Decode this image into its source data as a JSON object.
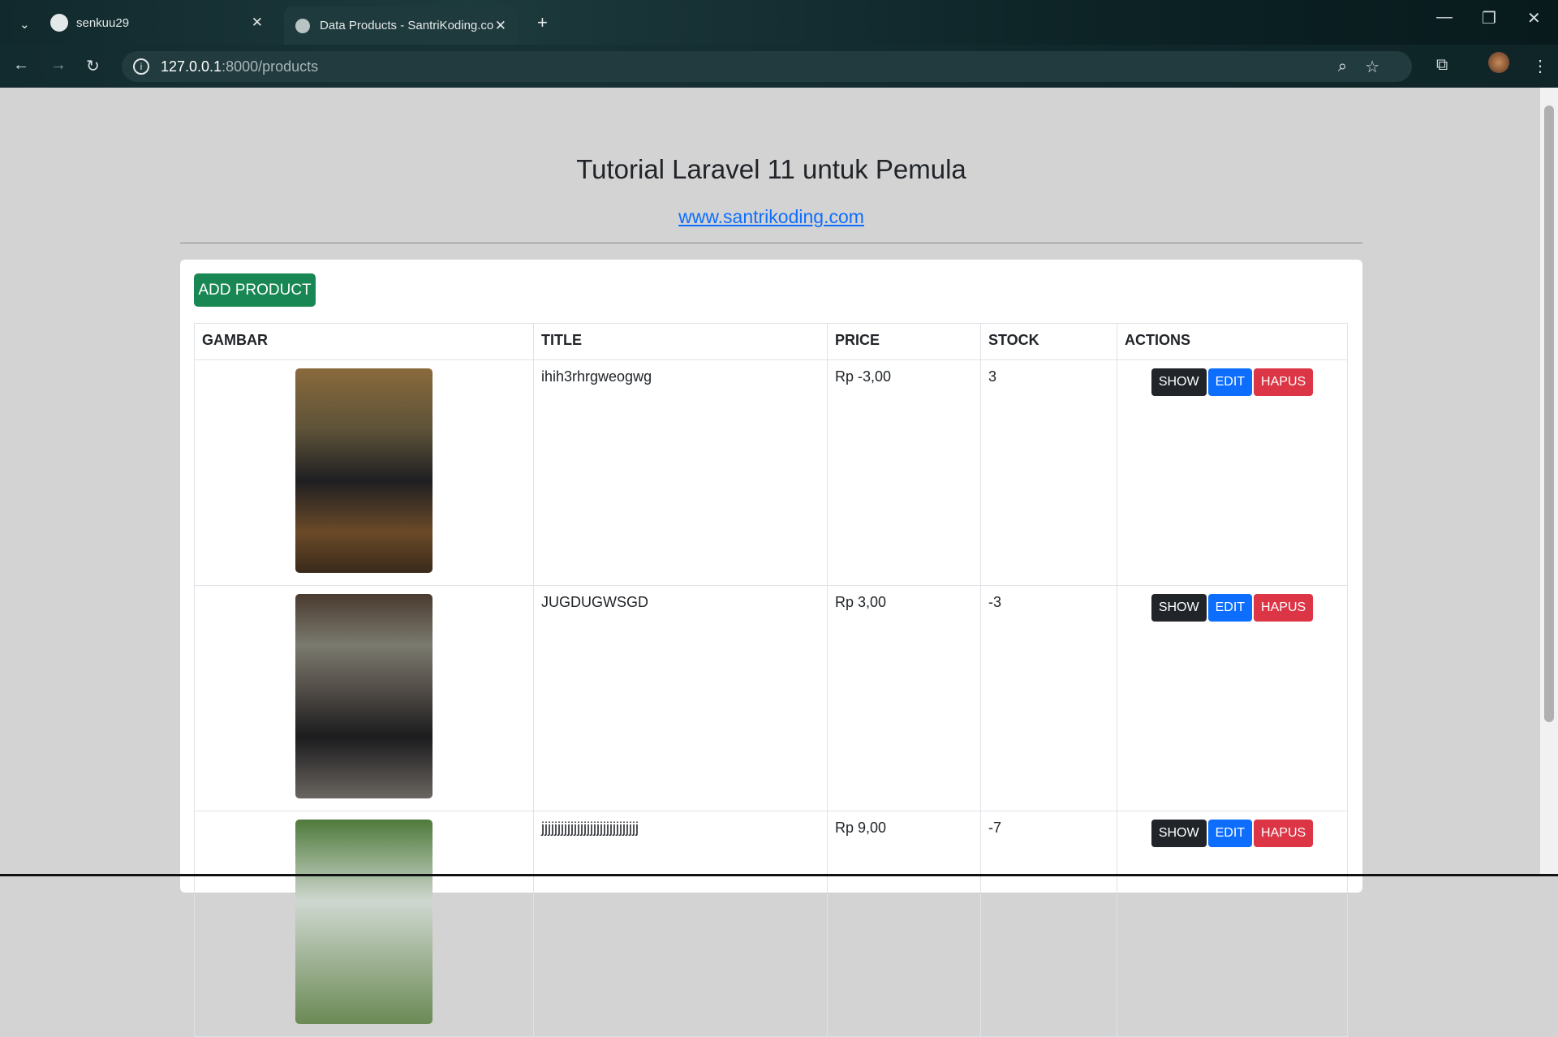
{
  "browser": {
    "tabs": [
      {
        "title": "senkuu29",
        "icon": "github-icon"
      },
      {
        "title": "Data Products - SantriKoding.co",
        "icon": "globe-icon"
      }
    ],
    "url_host": "127.0.0.1",
    "url_path": ":8000/products"
  },
  "header": {
    "title": "Tutorial Laravel 11 untuk Pemula",
    "link": "www.santrikoding.com"
  },
  "add_label": "ADD PRODUCT",
  "columns": [
    "GAMBAR",
    "TITLE",
    "PRICE",
    "STOCK",
    "ACTIONS"
  ],
  "actions": {
    "show": "SHOW",
    "edit": "EDIT",
    "delete": "HAPUS"
  },
  "rows": [
    {
      "title": "ihih3rhrgweogwg",
      "price": "Rp -3,00",
      "stock": "3"
    },
    {
      "title": "JUGDUGWSGD",
      "price": "Rp 3,00",
      "stock": "-3"
    },
    {
      "title": "jjjjjjjjjjjjjjjjjjjjjjjjjjjjjj",
      "price": "Rp 9,00",
      "stock": "-7"
    }
  ]
}
